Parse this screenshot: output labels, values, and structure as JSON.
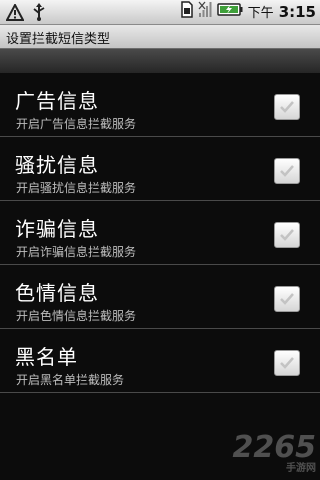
{
  "status_bar": {
    "time_label": "下午",
    "time": "3:15",
    "icons": [
      "warning-icon",
      "usb-icon",
      "sim-icon",
      "signal-icon",
      "battery-charging-icon"
    ]
  },
  "title_bar": {
    "title": "设置拦截短信类型"
  },
  "settings": [
    {
      "title": "广告信息",
      "summary": "开启广告信息拦截服务",
      "checked": true
    },
    {
      "title": "骚扰信息",
      "summary": "开启骚扰信息拦截服务",
      "checked": true
    },
    {
      "title": "诈骗信息",
      "summary": "开启诈骗信息拦截服务",
      "checked": true
    },
    {
      "title": "色情信息",
      "summary": "开启色情信息拦截服务",
      "checked": true
    },
    {
      "title": "黑名单",
      "summary": "开启黑名单拦截服务",
      "checked": true
    }
  ],
  "watermark": {
    "text": "2265",
    "sub": "手游网"
  }
}
